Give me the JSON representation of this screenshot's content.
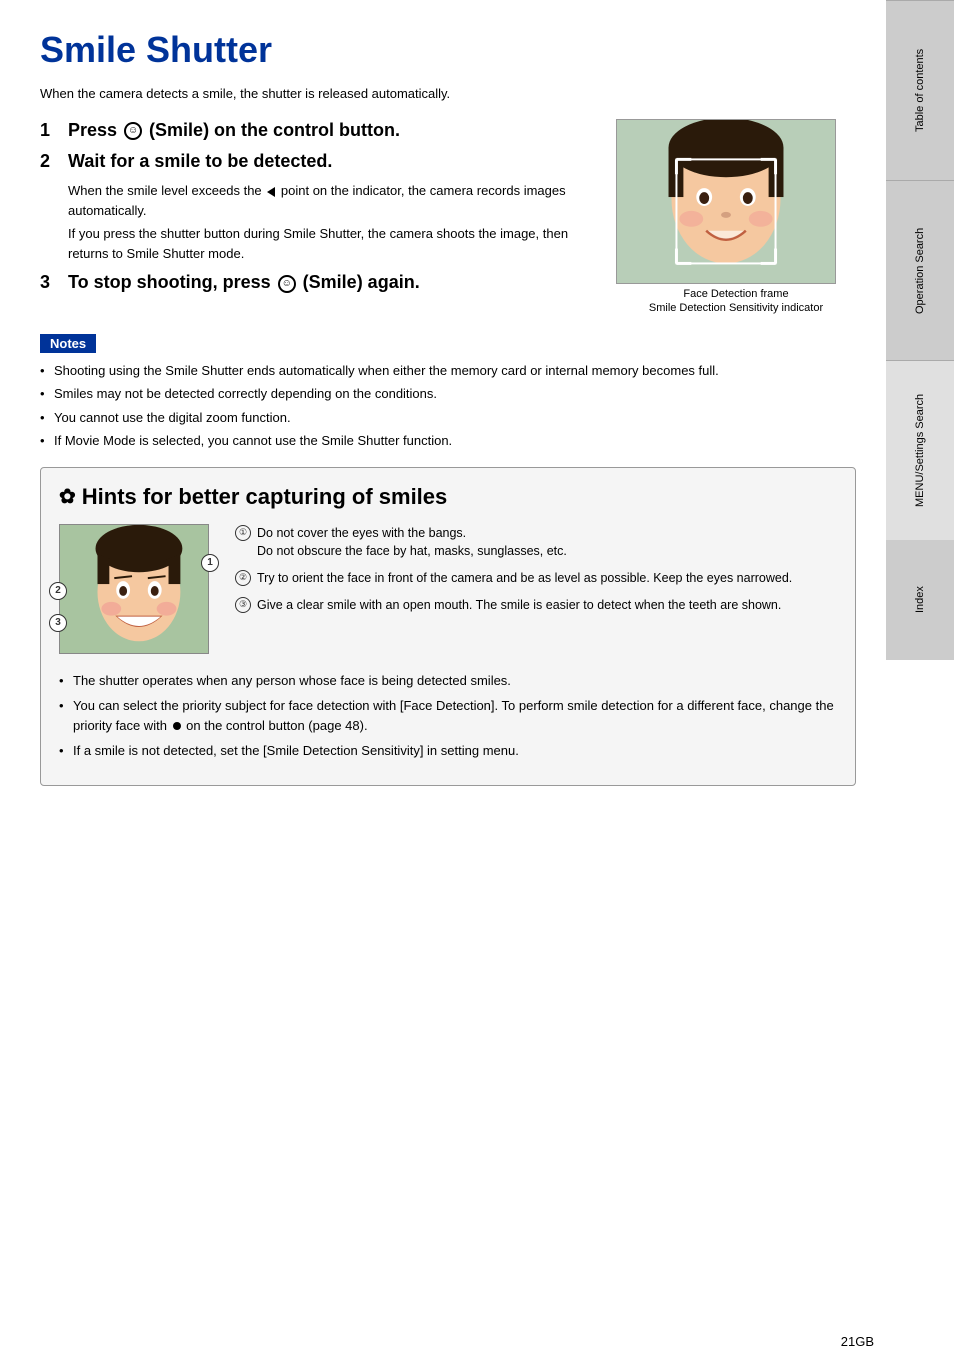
{
  "page": {
    "title": "Smile Shutter",
    "intro": "When the camera detects a smile, the shutter is released automatically.",
    "steps": [
      {
        "number": "1",
        "text": "Press  (Smile) on the control button."
      },
      {
        "number": "2",
        "text": "Wait for a smile to be detected.",
        "desc1": "When the smile level exceeds the ◄ point on the indicator, the camera records images automatically.",
        "desc2": "If you press the shutter button during Smile Shutter, the camera shoots the image, then returns to Smile Shutter mode."
      },
      {
        "number": "3",
        "text": "To stop shooting, press  (Smile) again."
      }
    ],
    "image_captions": {
      "face_detection": "Face Detection frame",
      "smile_sensitivity": "Smile Detection Sensitivity indicator"
    },
    "notes": {
      "label": "Notes",
      "items": [
        "Shooting using the Smile Shutter ends automatically when either the memory card or internal memory becomes full.",
        "Smiles may not be detected correctly depending on the conditions.",
        "You cannot use the digital zoom function.",
        "If Movie Mode is selected, you cannot use the Smile Shutter function."
      ]
    },
    "hints": {
      "title": "Hints for better capturing of smiles",
      "numbered_items": [
        {
          "num": "①",
          "text": "Do not cover the eyes with the bangs.\nDo not obscure the face by hat, masks, sunglasses, etc."
        },
        {
          "num": "②",
          "text": "Try to orient the face in front of the camera and be as level as possible. Keep the eyes narrowed."
        },
        {
          "num": "③",
          "text": "Give a clear smile with an open mouth. The smile is easier to detect when the teeth are shown."
        }
      ],
      "extra_items": [
        "The shutter operates when any person whose face is being detected smiles.",
        "You can select the priority subject for face detection with [Face Detection]. To perform smile detection for a different face, change the priority face with ● on the control button (page 48).",
        "If a smile is not detected, set the [Smile Detection Sensitivity] in setting menu."
      ]
    }
  },
  "sidebar": {
    "tabs": [
      {
        "label": "Table of contents"
      },
      {
        "label": "Operation Search"
      },
      {
        "label": "MENU/Settings Search"
      },
      {
        "label": "Index"
      }
    ]
  },
  "footer": {
    "page_number": "21GB"
  }
}
